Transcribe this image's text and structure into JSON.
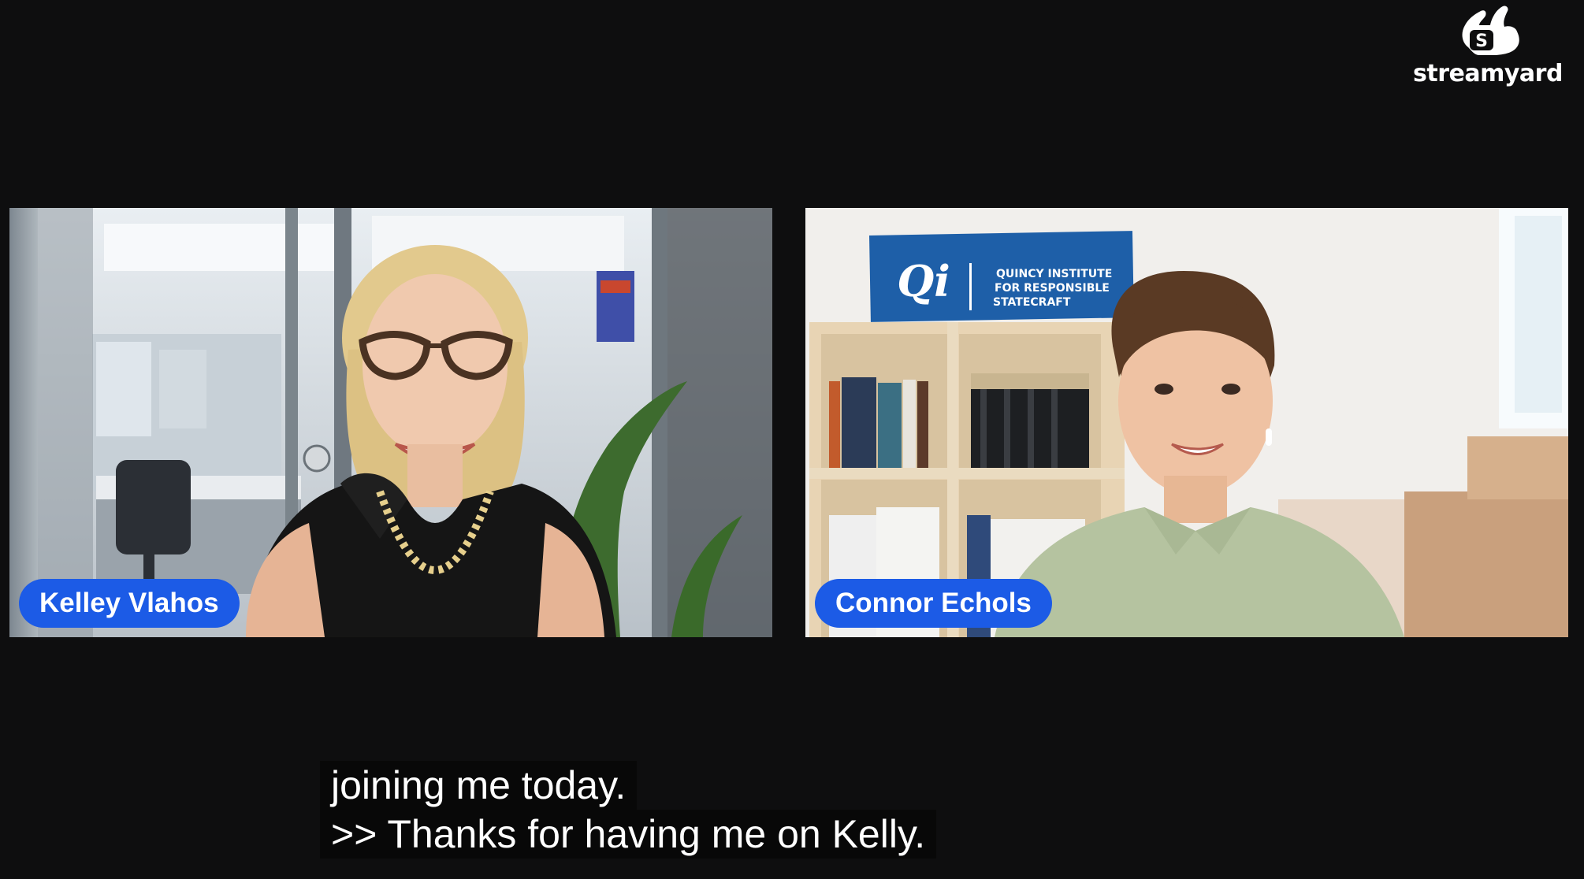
{
  "brand": {
    "name": "streamyard",
    "icon": "streamyard-logo-icon"
  },
  "participants": [
    {
      "name": "Kelley Vlahos",
      "accent": "#1c5be6"
    },
    {
      "name": "Connor Echols",
      "accent": "#1c5be6"
    }
  ],
  "background_sign": {
    "logo": "Qi",
    "lines": [
      "QUINCY INSTITUTE",
      "FOR RESPONSIBLE",
      "STATECRAFT"
    ]
  },
  "captions": {
    "line1": "joining me today.",
    "line2": ">> Thanks for having me on Kelly."
  },
  "colors": {
    "background": "#0e0e0f",
    "name_pill": "#1c5be6",
    "caption_bg": "#080808"
  }
}
